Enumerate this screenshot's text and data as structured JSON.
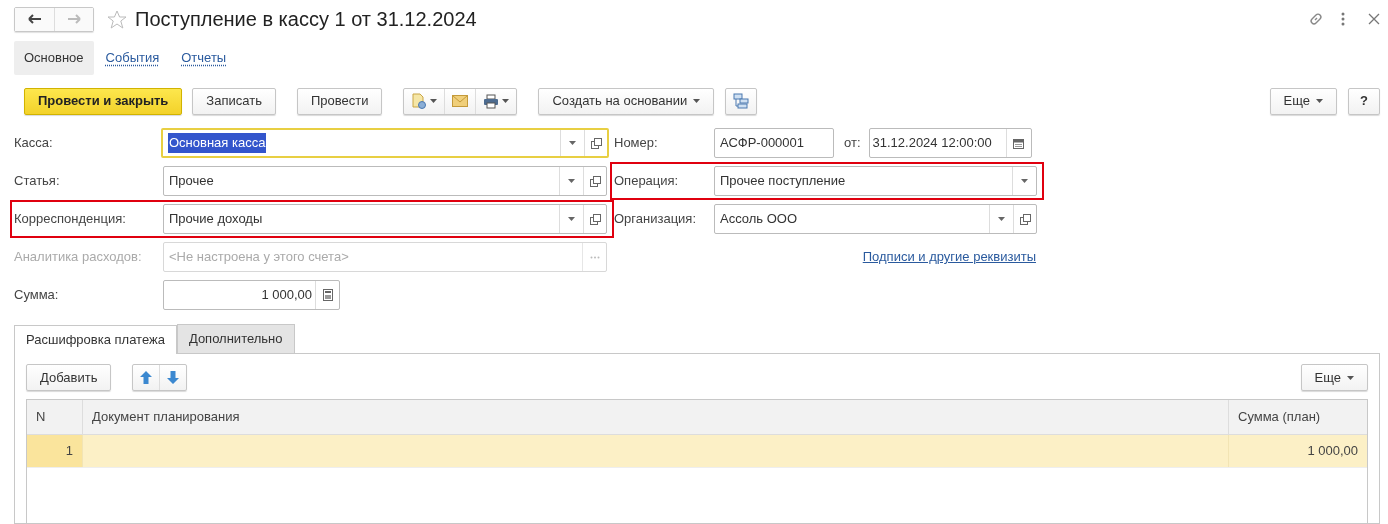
{
  "window": {
    "title": "Поступление в кассу 1 от 31.12.2024",
    "favorite": false,
    "back_enabled": true,
    "forward_enabled": false
  },
  "sections": [
    {
      "label": "Основное",
      "selected": true
    },
    {
      "label": "События",
      "selected": false
    },
    {
      "label": "Отчеты",
      "selected": false
    }
  ],
  "toolbar": [
    {
      "kind": "primary",
      "label": "Провести и закрыть"
    },
    {
      "kind": "text",
      "label": "Записать"
    },
    {
      "kind": "text",
      "label": "Провести"
    },
    {
      "kind": "icon_group"
    },
    {
      "kind": "menu",
      "label": "Создать на основании"
    },
    {
      "kind": "structure"
    }
  ],
  "toolbar_more": "Еще",
  "help": "?",
  "left_fields": [
    {
      "kind": "select",
      "label": "Касса:",
      "value": "Основная касса",
      "focused": true,
      "text_selected": true,
      "highlighted": false
    },
    {
      "kind": "select",
      "label": "Статья:",
      "value": "Прочее",
      "focused": false,
      "text_selected": false,
      "highlighted": false
    },
    {
      "kind": "select",
      "label": "Корреспонденция:",
      "value": "Прочие доходы",
      "focused": false,
      "text_selected": false,
      "highlighted": true
    },
    {
      "kind": "disabled",
      "label": "Аналитика расходов:",
      "placeholder": "<Не настроена у этого счета>",
      "highlighted": false
    },
    {
      "kind": "number",
      "label": "Сумма:",
      "value": "1 000,00",
      "highlighted": false
    }
  ],
  "number": {
    "label": "Номер:",
    "value": "АСФР-000001",
    "date_label": "от:",
    "date": "31.12.2024 12:00:00"
  },
  "right_fields": [
    {
      "kind": "dropdown",
      "label": "Операция:",
      "value": "Прочее поступление",
      "highlighted": true
    },
    {
      "kind": "select",
      "label": "Организация:",
      "value": "Ассоль ООО",
      "highlighted": false
    }
  ],
  "details_link": "Подписи и другие реквизиты",
  "tabs": [
    {
      "label": "Расшифровка платежа",
      "selected": true
    },
    {
      "label": "Дополнительно",
      "selected": false
    }
  ],
  "table_toolbar": {
    "add": "Добавить",
    "more": "Еще"
  },
  "table": {
    "columns": [
      "N",
      "Документ планирования",
      "Сумма (план)"
    ],
    "rows": [
      {
        "n": "1",
        "amount": "1 000,00",
        "selected": true
      }
    ]
  }
}
